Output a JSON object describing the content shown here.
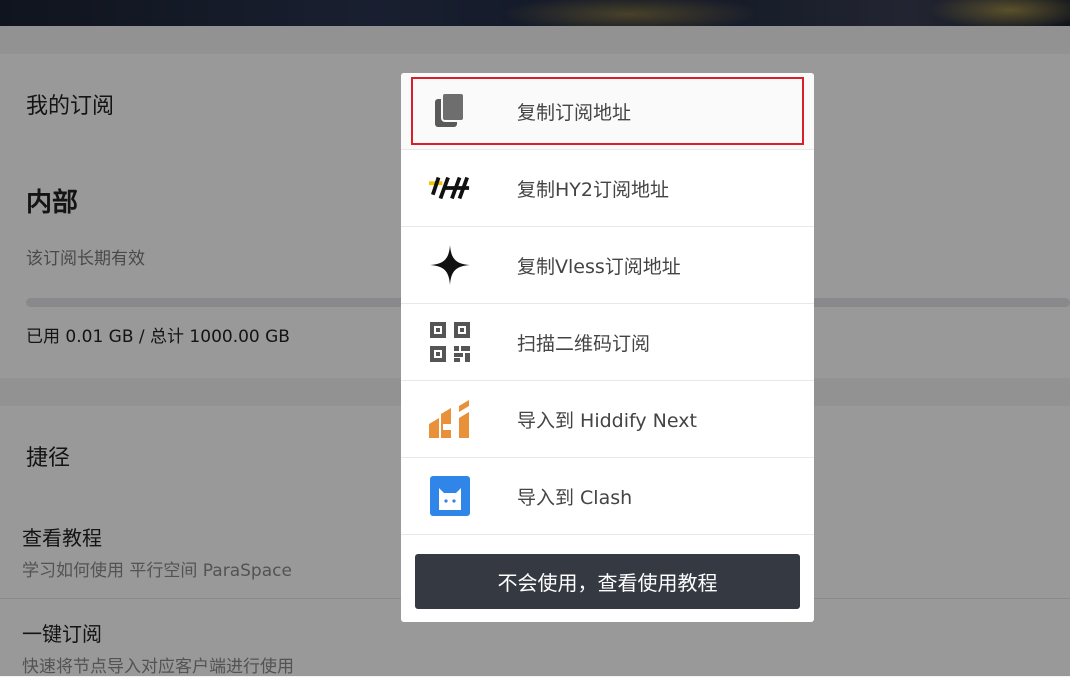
{
  "subscription": {
    "heading": "我的订阅",
    "plan_name": "内部",
    "validity": "该订阅长期有效",
    "usage": "已用 0.01 GB / 总计 1000.00 GB",
    "used_gb": 0.01,
    "total_gb": 1000.0
  },
  "shortcuts": {
    "heading": "捷径",
    "items": [
      {
        "title": "查看教程",
        "subtitle": "学习如何使用 平行空间 ParaSpace"
      },
      {
        "title": "一键订阅",
        "subtitle": "快速将节点导入对应客户端进行使用"
      }
    ]
  },
  "modal": {
    "options": [
      {
        "label": "复制订阅地址",
        "icon": "copy-icon"
      },
      {
        "label": "复制HY2订阅地址",
        "icon": "hysteria-icon"
      },
      {
        "label": "复制Vless订阅地址",
        "icon": "vless-star-icon"
      },
      {
        "label": "扫描二维码订阅",
        "icon": "qr-code-icon"
      },
      {
        "label": "导入到 Hiddify Next",
        "icon": "hiddify-icon"
      },
      {
        "label": "导入到 Clash",
        "icon": "clash-icon"
      }
    ],
    "help_button": "不会使用，查看使用教程"
  },
  "colors": {
    "progress": "#4a74d6",
    "highlight_border": "#d81f2a",
    "button_bg": "#353a42",
    "hiddify": "#e8913a",
    "clash": "#2f86e8"
  }
}
